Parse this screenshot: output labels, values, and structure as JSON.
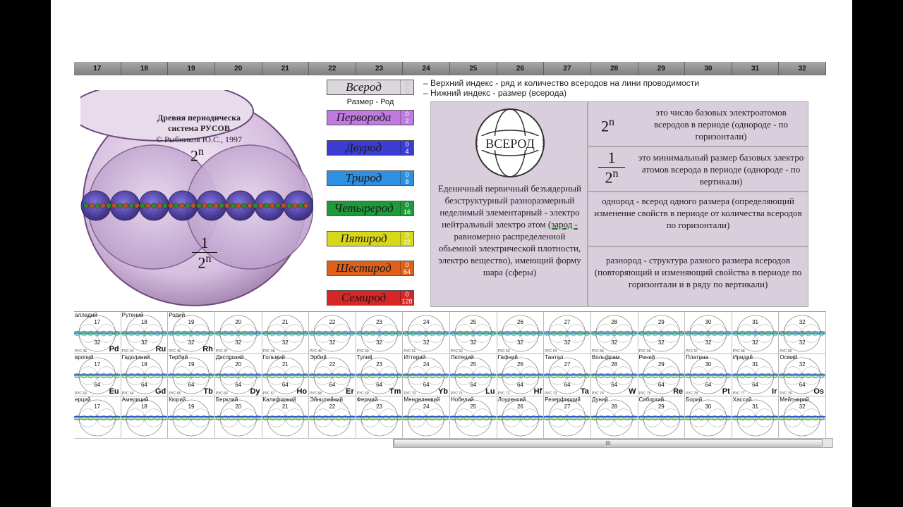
{
  "columns": [
    "17",
    "18",
    "19",
    "20",
    "21",
    "22",
    "23",
    "24",
    "25",
    "26",
    "27",
    "28",
    "29",
    "30",
    "31",
    "32"
  ],
  "sphere": {
    "title": "Древня  периодическа\nсистема РУСОВ",
    "copyright": "© Рыбников Ю.С., 1997",
    "top_base": "2",
    "top_exp": "n",
    "frac_num": "1",
    "frac_den": "2",
    "frac_exp": "n"
  },
  "generations": [
    {
      "name": "Всерод",
      "top": "0",
      "bottom": "0",
      "color": "#dcd7dc"
    },
    {
      "name": "Перворода",
      "top": "0",
      "bottom": "2",
      "color": "#c07be0"
    },
    {
      "name": "Двурод",
      "top": "0",
      "bottom": "4",
      "color": "#3c3cd4"
    },
    {
      "name": "Трирод",
      "top": "0",
      "bottom": "8",
      "color": "#2f8fe0"
    },
    {
      "name": "Четырерод",
      "top": "0",
      "bottom": "16",
      "color": "#1f9a3a"
    },
    {
      "name": "Пятирод",
      "top": "0",
      "bottom": "32",
      "color": "#d8d81a"
    },
    {
      "name": "Шестирод",
      "top": "0",
      "bottom": "64",
      "color": "#e0601a"
    },
    {
      "name": "Семирод",
      "top": "0",
      "bottom": "128",
      "color": "#d62626"
    }
  ],
  "razmer_label": "Размер - Род",
  "legend": {
    "line1": "– Верхний индекс - ряд и количество всеродов на лини проводимости",
    "line2": "– Нижний индекс - размер (всерода)"
  },
  "info": {
    "logo": "ВСЕРОД",
    "text_before": "Еденичный первичный безъядерный безструктурный разноразмерный неделимый элементарный - электро нейтральный электро атом ",
    "zarod": "(зарод -",
    "text_after": " равномерно распределенной обьемной электрической плотности, электро веществo), имеющий форму шара (сферы)"
  },
  "right": {
    "r1_base": "2",
    "r1_exp": "n",
    "r1_text": "это число базовых электроатомов всеродов в периоде (однороде - по горизонтали)",
    "r2_num": "1",
    "r2_den": "2",
    "r2_exp": "n",
    "r2_text": "это минимальный размер базовых электро атомов всерода в периоде (однороде -  по вертикали)",
    "r3_text": "однород - всерод одного размера (определяющий изменение свойств в периоде от количества всеродов по горизонтали)",
    "r4_text": "разнород - структура разного размера всеродов (повторяющий и изменяющий свойства в периоде по горизонтали и в ряду по вертикали)"
  },
  "table_rows": [
    {
      "bottom": "32",
      "cells": [
        {
          "name": "алладий",
          "sym": "Pd",
          "ru": "РУС 46"
        },
        {
          "name": "Рутений",
          "sym": "Ru",
          "ru": "РУС 44"
        },
        {
          "name": "Родий",
          "sym": "Rh",
          "ru": "РУС 45"
        },
        {
          "name": "",
          "sym": "",
          "ru": "РУС 47"
        },
        {
          "name": "",
          "sym": "",
          "ru": "РУС 48"
        },
        {
          "name": "",
          "sym": "",
          "ru": "РУС 49"
        },
        {
          "name": "",
          "sym": "",
          "ru": "РУС 50"
        },
        {
          "name": "",
          "sym": "",
          "ru": "РУС 51"
        },
        {
          "name": "",
          "sym": "",
          "ru": "РУС 52"
        },
        {
          "name": "",
          "sym": "",
          "ru": "РУС 53"
        },
        {
          "name": "",
          "sym": "",
          "ru": "РУС 54"
        },
        {
          "name": "",
          "sym": "",
          "ru": "РУС 55"
        },
        {
          "name": "",
          "sym": "",
          "ru": "РУС 56"
        },
        {
          "name": "",
          "sym": "",
          "ru": "РУС 57"
        },
        {
          "name": "",
          "sym": "",
          "ru": "РУС 58"
        },
        {
          "name": "",
          "sym": "",
          "ru": "РУС 59"
        }
      ]
    },
    {
      "bottom": "64",
      "cells": [
        {
          "name": "вропий",
          "sym": "Eu",
          "ru": "РУС 63"
        },
        {
          "name": "Гадолиний",
          "sym": "Gd",
          "ru": "РУС 64"
        },
        {
          "name": "Тербий",
          "sym": "Tb",
          "ru": "РУС 65"
        },
        {
          "name": "Диспрозий",
          "sym": "Dy",
          "ru": "РУС 66"
        },
        {
          "name": "Гольмий",
          "sym": "Ho",
          "ru": "РУС 67"
        },
        {
          "name": "Эрбий",
          "sym": "Er",
          "ru": "РУС 68"
        },
        {
          "name": "Тулий",
          "sym": "Tm",
          "ru": "РУС 69"
        },
        {
          "name": "Иттерий",
          "sym": "Yb",
          "ru": "РУС 70"
        },
        {
          "name": "Лютеций",
          "sym": "Lu",
          "ru": "РУС 71"
        },
        {
          "name": "Гафний",
          "sym": "Hf",
          "ru": "РУС 72"
        },
        {
          "name": "Тантал",
          "sym": "Ta",
          "ru": "РУС 73"
        },
        {
          "name": "Вольфрам",
          "sym": "W",
          "ru": "РУС 74"
        },
        {
          "name": "Рений",
          "sym": "Re",
          "ru": "РУС 75"
        },
        {
          "name": "Платина",
          "sym": "Pt",
          "ru": "РУС 78"
        },
        {
          "name": "Иридий",
          "sym": "Ir",
          "ru": "РУС 77"
        },
        {
          "name": "Осмий",
          "sym": "Os",
          "ru": "РУС 76"
        }
      ]
    },
    {
      "bottom": "",
      "cells": [
        {
          "name": "ерций",
          "sym": "",
          "ru": ""
        },
        {
          "name": "Америций",
          "sym": "",
          "ru": ""
        },
        {
          "name": "Кюрий",
          "sym": "",
          "ru": ""
        },
        {
          "name": "Берклий",
          "sym": "",
          "ru": ""
        },
        {
          "name": "Калифорний",
          "sym": "",
          "ru": ""
        },
        {
          "name": "Эйнштейний",
          "sym": "",
          "ru": ""
        },
        {
          "name": "Фермий",
          "sym": "",
          "ru": ""
        },
        {
          "name": "Менделеевий",
          "sym": "",
          "ru": ""
        },
        {
          "name": "Нобелий",
          "sym": "",
          "ru": ""
        },
        {
          "name": "Лоуренсий",
          "sym": "",
          "ru": ""
        },
        {
          "name": "Резерфордий",
          "sym": "",
          "ru": ""
        },
        {
          "name": "Дуний",
          "sym": "",
          "ru": ""
        },
        {
          "name": "Сиборгий",
          "sym": "",
          "ru": ""
        },
        {
          "name": "Борий",
          "sym": "",
          "ru": ""
        },
        {
          "name": "Хассий",
          "sym": "",
          "ru": ""
        },
        {
          "name": "Мейтнерий",
          "sym": "",
          "ru": ""
        }
      ]
    }
  ],
  "scrollbar": {
    "grip": "III"
  }
}
